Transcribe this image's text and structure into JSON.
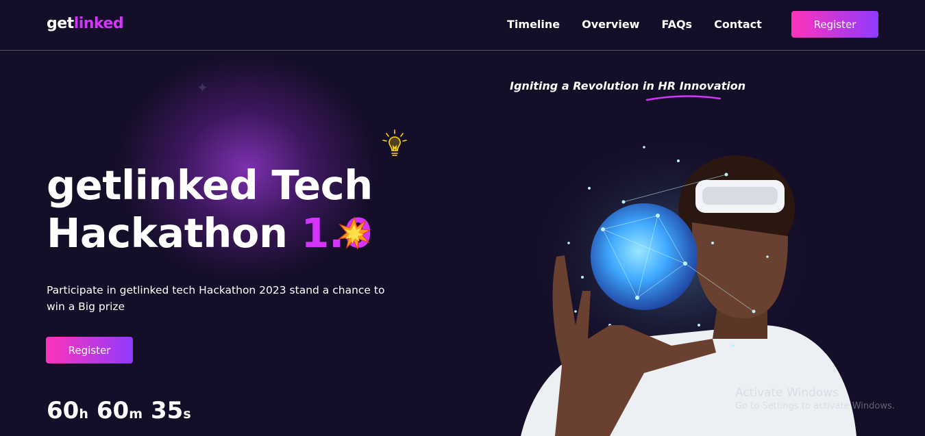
{
  "header": {
    "logo_main": "get",
    "logo_accent": "linked",
    "nav": [
      "Timeline",
      "Overview",
      "FAQs",
      "Contact"
    ],
    "register_label": "Register"
  },
  "hero": {
    "tagline_prefix": "Igniting a Revolution in ",
    "tagline_emphasis": "HR Innovation",
    "title_line1": "getlinked Tech",
    "title_line2": "Hackathon ",
    "title_version": "1.0",
    "description": "Participate in getlinked tech Hackathon 2023 stand a chance to win a Big prize",
    "register_label": "Register",
    "countdown": {
      "hours": "60",
      "hours_unit": "h",
      "minutes": "60",
      "minutes_unit": "m",
      "seconds": "35",
      "seconds_unit": "s"
    }
  },
  "watermark": {
    "title": "Activate Windows",
    "subtitle": "Go to Settings to activate Windows."
  },
  "colors": {
    "background": "#150e28",
    "accent": "#d434fe",
    "button_gradient_start": "#fe34b9",
    "button_gradient_end": "#903aff"
  },
  "icons": [
    "star-sparkle-icon",
    "lightbulb-icon",
    "explosion-icon"
  ]
}
